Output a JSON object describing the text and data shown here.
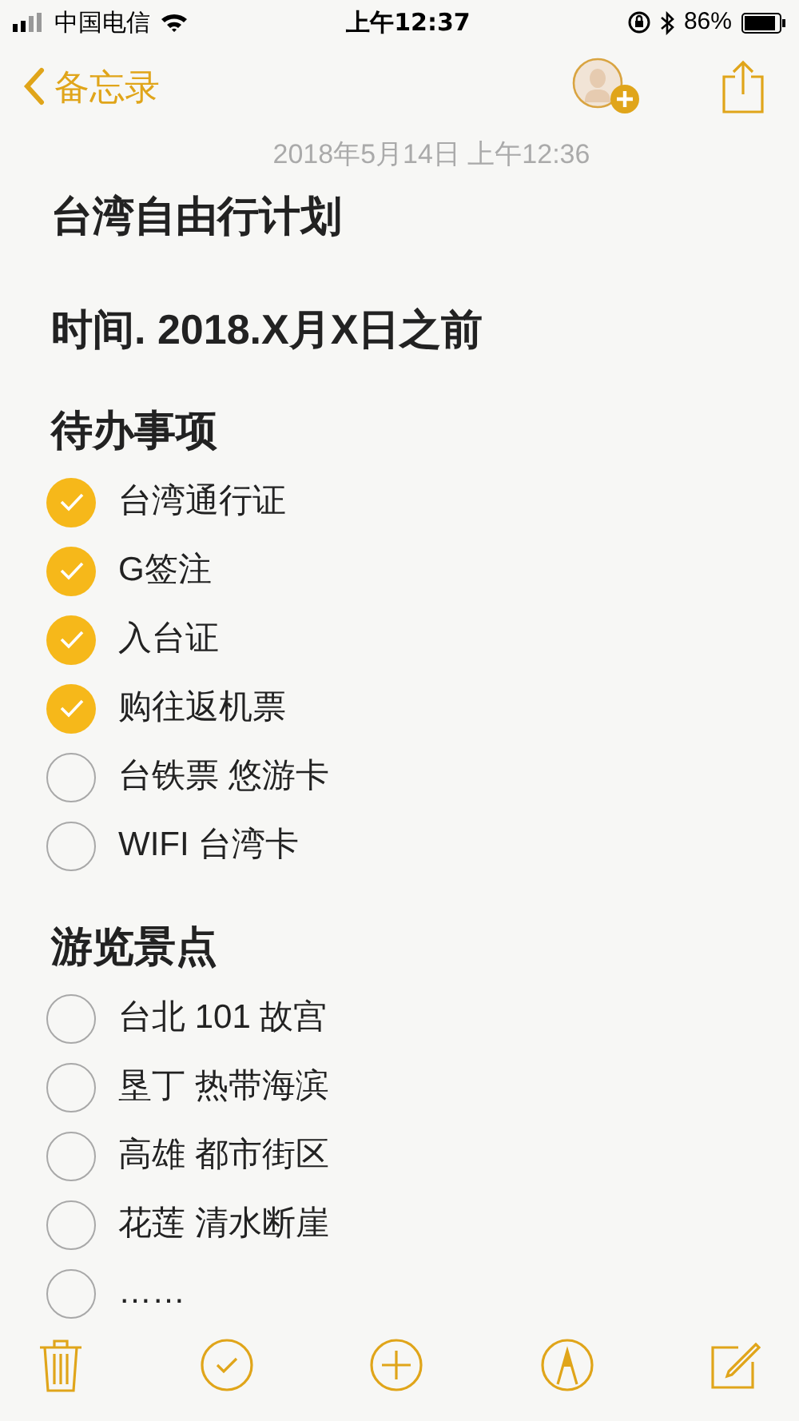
{
  "status_bar": {
    "carrier": "中国电信",
    "time": "上午12:37",
    "battery": "86%"
  },
  "nav": {
    "back_label": "备忘录"
  },
  "note": {
    "date": "2018年5月14日 上午12:36",
    "blocks": [
      {
        "kind": "heading",
        "text": "台湾自由行计划"
      },
      {
        "kind": "heading",
        "text": "时间. 2018.X月X日之前"
      },
      {
        "kind": "section",
        "text": "待办事项",
        "items": [
          {
            "text": "台湾通行证",
            "checked": true
          },
          {
            "text": "G签注",
            "checked": true
          },
          {
            "text": "入台证",
            "checked": true
          },
          {
            "text": "购往返机票",
            "checked": true
          },
          {
            "text": "台铁票 悠游卡",
            "checked": false
          },
          {
            "text": "WIFI 台湾卡",
            "checked": false
          }
        ]
      },
      {
        "kind": "section",
        "text": "游览景点",
        "items": [
          {
            "text": "台北 101 故宫",
            "checked": false
          },
          {
            "text": "垦丁 热带海滨",
            "checked": false
          },
          {
            "text": "高雄 都市街区",
            "checked": false
          },
          {
            "text": "花莲 清水断崖",
            "checked": false
          },
          {
            "text": "……",
            "checked": false
          }
        ]
      }
    ]
  }
}
